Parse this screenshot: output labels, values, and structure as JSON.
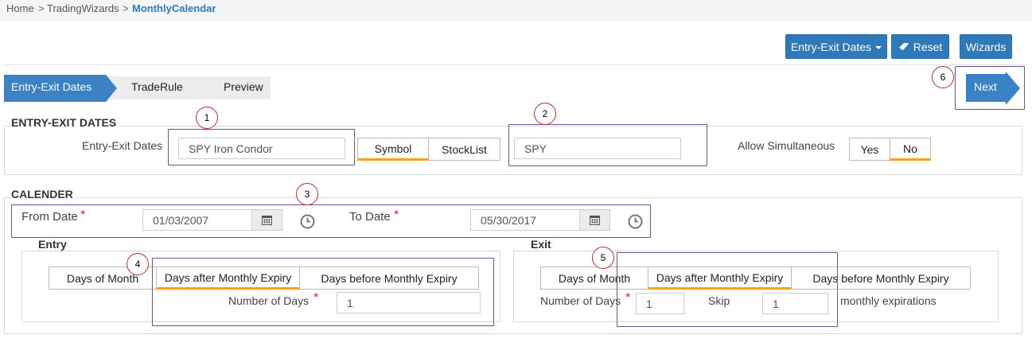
{
  "breadcrumb": {
    "items": [
      "Home",
      "TradingWizards",
      "MonthlyCalendar"
    ],
    "separator": ">"
  },
  "toolbar": {
    "entry_exit_dates_label": "Entry-Exit Dates",
    "reset_label": "Reset",
    "wizards_label": "Wizards",
    "accent_color": "#2e79b9"
  },
  "wizard": {
    "steps": [
      "Entry-Exit Dates",
      "TradeRule",
      "Preview"
    ],
    "active_step": "Entry-Exit Dates",
    "next_label": "Next"
  },
  "entry_exit_section": {
    "legend": "ENTRY-EXIT DATES",
    "entry_exit_label": "Entry-Exit Dates",
    "entry_exit_value": "SPY Iron Condor",
    "symbol_toggle": [
      "Symbol",
      "StockList"
    ],
    "symbol_selected": "Symbol",
    "symbol_value": "SPY",
    "allow_simultaneous_label": "Allow Simultaneous",
    "allow_simultaneous_options": [
      "Yes",
      "No"
    ],
    "allow_simultaneous_selected": "No"
  },
  "calendar_section": {
    "legend": "CALENDER",
    "from_date_label": "From Date",
    "from_date_value": "01/03/2007",
    "to_date_label": "To Date",
    "to_date_value": "05/30/2017",
    "required_mark": "*"
  },
  "entry": {
    "legend": "Entry",
    "tabs": [
      "Days of Month",
      "Days after Monthly Expiry",
      "Days before Monthly Expiry"
    ],
    "selected_tab": "Days after Monthly Expiry",
    "number_of_days_label": "Number of Days",
    "number_of_days_value": "1"
  },
  "exit": {
    "legend": "Exit",
    "tabs": [
      "Days of Month",
      "Days after Monthly Expiry",
      "Days before Monthly Expiry"
    ],
    "selected_tab": "Days after Monthly Expiry",
    "number_of_days_label": "Number of Days",
    "number_of_days_value": "1",
    "skip_label": "Skip",
    "skip_value": "1",
    "suffix_label": "monthly expirations"
  },
  "annotations": [
    "1",
    "2",
    "3",
    "4",
    "5",
    "6"
  ],
  "colors": {
    "highlight_box": "#7b4d94",
    "annotation_circle": "#c62b2b",
    "selected_underline": "#f4a21a",
    "step_active": "#3a82c4"
  }
}
